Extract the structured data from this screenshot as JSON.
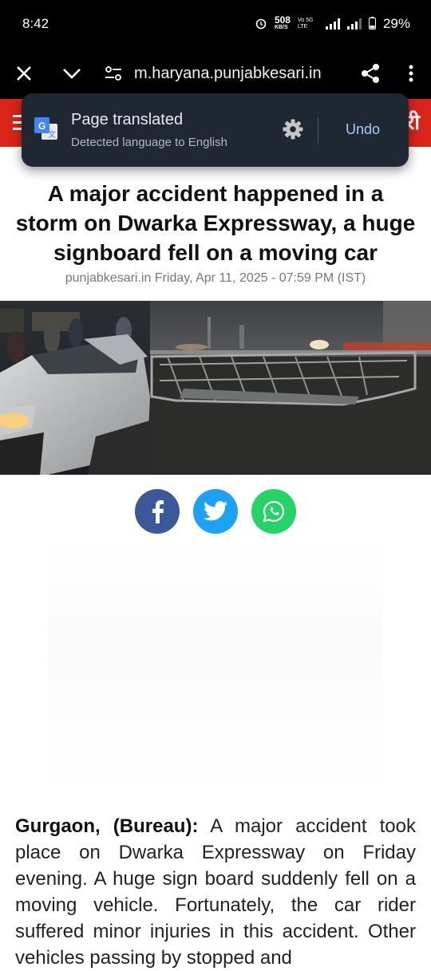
{
  "status": {
    "time": "8:42",
    "data_speed": "508",
    "data_unit": "KB/S",
    "network_1": "Vo 5G LTE",
    "battery": "29%"
  },
  "toolbar": {
    "url": "m.haryana.punjabkesari.in"
  },
  "site": {
    "logo_partial": "री"
  },
  "translate_popup": {
    "title": "Page translated",
    "subtitle": "Detected language to English",
    "undo_label": "Undo"
  },
  "article": {
    "headline": "A major accident happened in a storm on Dwarka Expressway, a huge signboard fell on a moving car",
    "byline": "punjabkesari.in Friday, Apr 11, 2025 - 07:59 PM (IST)",
    "lead_bold": "Gurgaon, (Bureau):",
    "body": " A major accident took place on Dwarka Expressway on Friday evening. A huge sign board suddenly fell on a moving vehicle. Fortunately, the car rider suffered minor injuries in this accident. Other vehicles passing by stopped and"
  },
  "colors": {
    "brand_red": "#d9241a",
    "popup_bg": "#1f2733",
    "undo_blue": "#a8c7fa",
    "facebook": "#3b5998",
    "twitter": "#1da1f2",
    "whatsapp": "#25d366"
  }
}
